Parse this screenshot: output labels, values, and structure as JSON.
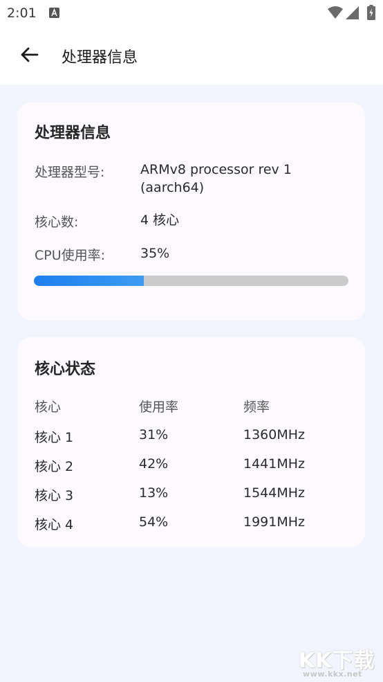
{
  "status_bar": {
    "time": "2:01"
  },
  "app_bar": {
    "title": "处理器信息"
  },
  "processor_card": {
    "title": "处理器信息",
    "model_label": "处理器型号:",
    "model_value": "ARMv8 processor rev 1 (aarch64)",
    "cores_label": "核心数:",
    "cores_value": "4 核心",
    "usage_label": "CPU使用率:",
    "usage_value": "35%",
    "usage_fraction": 0.35,
    "progress_color": "#1e7ef0"
  },
  "cores_card": {
    "title": "核心状态",
    "headers": [
      "核心",
      "使用率",
      "频率"
    ],
    "rows": [
      [
        "核心 1",
        "31%",
        "1360MHz"
      ],
      [
        "核心 2",
        "42%",
        "1441MHz"
      ],
      [
        "核心 3",
        "13%",
        "1544MHz"
      ],
      [
        "核心 4",
        "54%",
        "1991MHz"
      ]
    ]
  },
  "watermark": {
    "brand": "KK下载",
    "url": "www.kkx.net"
  }
}
